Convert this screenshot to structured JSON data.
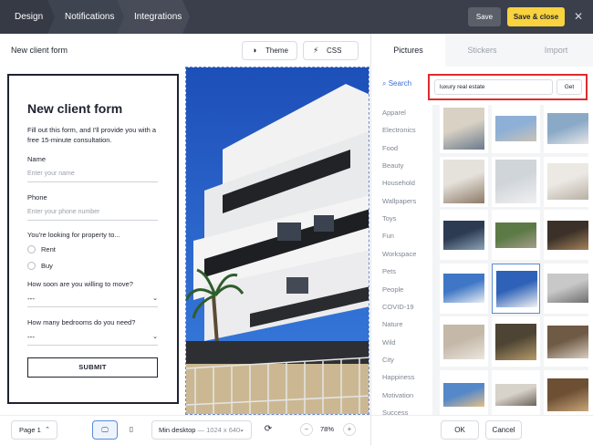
{
  "topbar": {
    "breadcrumbs": [
      "Design",
      "Notifications",
      "Integrations"
    ],
    "save_label": "Save",
    "save_close_label": "Save & close",
    "close_icon": "close-icon"
  },
  "editor": {
    "form_name": "New client form",
    "theme_label": "Theme",
    "css_label": "CSS"
  },
  "form": {
    "title": "New client form",
    "description": "Fill out this form, and I'll provide you with a free 15-minute consultation.",
    "name_label": "Name",
    "name_placeholder": "Enter your name",
    "phone_label": "Phone",
    "phone_placeholder": "Enter your phone number",
    "property_label": "You're looking for property to...",
    "options": [
      "Rent",
      "Buy"
    ],
    "move_label": "How soon are you willing to move?",
    "move_value": "---",
    "bedrooms_label": "How many bedrooms do you need?",
    "bedrooms_value": "---",
    "submit_label": "SUBMIT"
  },
  "bottombar": {
    "page_select": "Page 1",
    "size_select": "Min desktop",
    "size_dims": "1024 x 640",
    "zoom": "78%"
  },
  "panel": {
    "tabs": [
      "Pictures",
      "Stickers",
      "Import"
    ],
    "active_tab": "Pictures",
    "search_link": "Search",
    "search_value": "luxury real estate",
    "get_label": "Get",
    "categories": [
      "Apparel",
      "Electronics",
      "Food",
      "Beauty",
      "Household",
      "Wallpapers",
      "Toys",
      "Fun",
      "Workspace",
      "Pets",
      "People",
      "COVID-19",
      "Nature",
      "Wild",
      "City",
      "Happiness",
      "Motivation",
      "Success"
    ],
    "ok_label": "OK",
    "cancel_label": "Cancel"
  },
  "colors": {
    "topbar": "#3a3f4b",
    "accent_yellow": "#f8d23f",
    "link_blue": "#3b6fd4",
    "highlight_red": "#e02b2b"
  }
}
